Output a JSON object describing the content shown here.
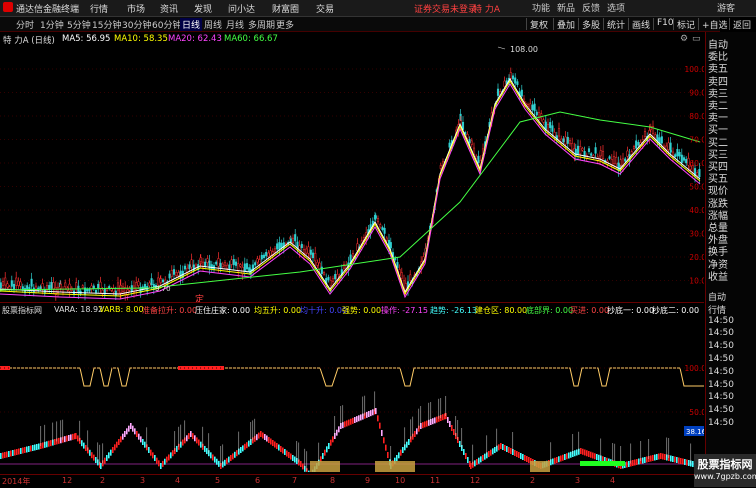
{
  "app": {
    "title": "通达信金融终端",
    "menu": [
      "行情",
      "市场",
      "资讯",
      "发现",
      "问小达",
      "财富圈",
      "交易"
    ],
    "warning": "证券交易未登录",
    "stock": "特 力A",
    "controls": [
      "功能",
      "新品",
      "反馈",
      "选项",
      "游客"
    ]
  },
  "periods": [
    "分时",
    "1分钟",
    "5分钟",
    "15分钟",
    "30分钟",
    "60分钟",
    "日线",
    "周线",
    "月线",
    "多周期",
    "更多"
  ],
  "active_period": "日线",
  "tools": [
    "复权",
    "叠加",
    "多股",
    "统计",
    "画线",
    "F10",
    "标记",
    "+自选",
    "返回"
  ],
  "chart_header": {
    "name": "特 力A (日线)",
    "ma": [
      {
        "label": "MA5: 56.95",
        "color": "#ffffff"
      },
      {
        "label": "MA10: 58.35",
        "color": "#ffff00"
      },
      {
        "label": "MA20: 62.43",
        "color": "#ff44ff"
      },
      {
        "label": "MA60: 66.67",
        "color": "#44ff44"
      }
    ]
  },
  "price_labels": [
    "100.0",
    "90.0",
    "80.0",
    "70.0",
    "60.0",
    "50.0",
    "40.0",
    "30.0",
    "20.0",
    "10.0"
  ],
  "peak_label": "108.00",
  "low_label": "9.70",
  "ding_label": "定",
  "indicator_header": [
    {
      "t": "股票指标网",
      "c": "#dddddd"
    },
    {
      "t": "VARA: 18.92",
      "c": "#dddddd"
    },
    {
      "t": "VARB: 8.00",
      "c": "#ffff00"
    },
    {
      "t": "准备拉升: 0.00",
      "c": "#ff4444"
    },
    {
      "t": "压住庄家: 0.00",
      "c": "#ffffff"
    },
    {
      "t": "均五升: 0.00",
      "c": "#ffff00"
    },
    {
      "t": "均十升: 0.00",
      "c": "#4444ff"
    },
    {
      "t": "强势: 0.00",
      "c": "#ffff00"
    },
    {
      "t": "操作: -27.15",
      "c": "#ff44ff"
    },
    {
      "t": "趋势: -26.13",
      "c": "#44ffff"
    },
    {
      "t": "建仓区: 80.00",
      "c": "#ffff00"
    },
    {
      "t": "底部界: 0.00",
      "c": "#44ff44"
    },
    {
      "t": "买进: 0.00",
      "c": "#ff4444"
    },
    {
      "t": "抄底一: 0.00",
      "c": "#ffffff"
    },
    {
      "t": "抄底二: 0.00",
      "c": "#ffffff"
    }
  ],
  "sub_labels": [
    "100.0",
    "50.0"
  ],
  "sub_value": "38.16",
  "sidebar": [
    "自动",
    "委比",
    "卖五",
    "卖四",
    "卖三",
    "卖二",
    "卖一",
    "买一",
    "买二",
    "买三",
    "买四",
    "买五",
    "现价",
    "涨跌",
    "涨幅",
    "总量",
    "外盘",
    "换手",
    "净资",
    "收益"
  ],
  "sidebar2": [
    "自动",
    "行情",
    "14:50",
    "14:50",
    "14:50",
    "14:50",
    "14:50",
    "14:50",
    "14:50",
    "14:50",
    "14:50"
  ],
  "x_labels": [
    "2014年",
    "12",
    "2",
    "3",
    "4",
    "5",
    "6",
    "7",
    "8",
    "9",
    "10",
    "11",
    "12",
    "2",
    "3",
    "4"
  ],
  "watermark": {
    "cn": "股票指标网",
    "url": "www.7gpzb.com"
  }
}
